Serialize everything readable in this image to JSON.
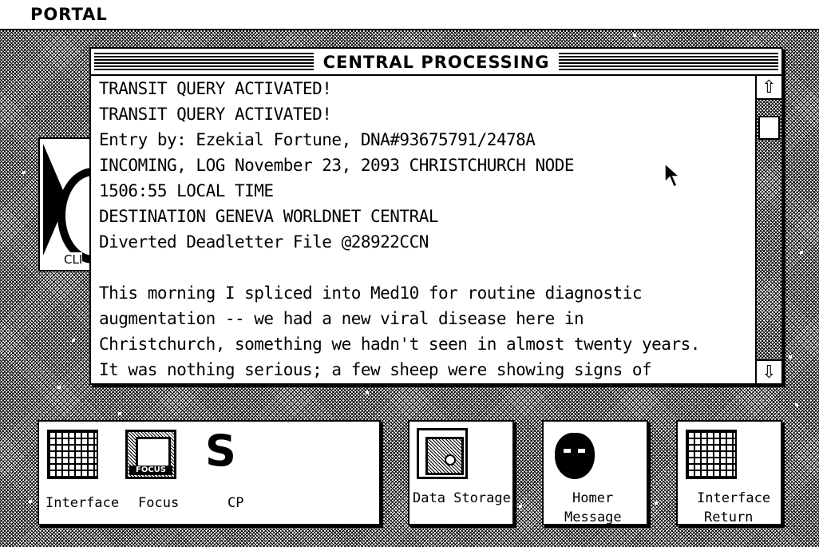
{
  "menubar": {
    "title": "PORTAL"
  },
  "background_icon": {
    "label": "CLI"
  },
  "window": {
    "title": "CENTRAL PROCESSING",
    "lines": [
      "TRANSIT QUERY ACTIVATED!",
      "TRANSIT QUERY ACTIVATED!",
      "Entry by: Ezekial Fortune, DNA#93675791/2478A",
      "INCOMING, LOG November 23, 2093 CHRISTCHURCH NODE",
      "1506:55 LOCAL TIME",
      "DESTINATION GENEVA WORLDNET CENTRAL",
      "Diverted Deadletter File @28922CCN",
      "",
      "This morning I spliced into Med10 for routine diagnostic",
      "augmentation -- we had a new viral disease here in",
      "Christchurch, something we hadn't seen in almost twenty years.",
      "It was nothing serious; a few sheep were showing signs of"
    ],
    "scroll_up_icon": "up-arrow",
    "scroll_down_icon": "down-arrow"
  },
  "dock": {
    "interface_label": "Interface",
    "focus_label": "Focus",
    "focus_icon_text": "FOCUS",
    "cp_label": "CP",
    "data_storage_label": "Data Storage",
    "homer_label_1": "Homer",
    "homer_label_2": "Message",
    "interface_return_label_1": "Interface",
    "interface_return_label_2": "Return"
  }
}
